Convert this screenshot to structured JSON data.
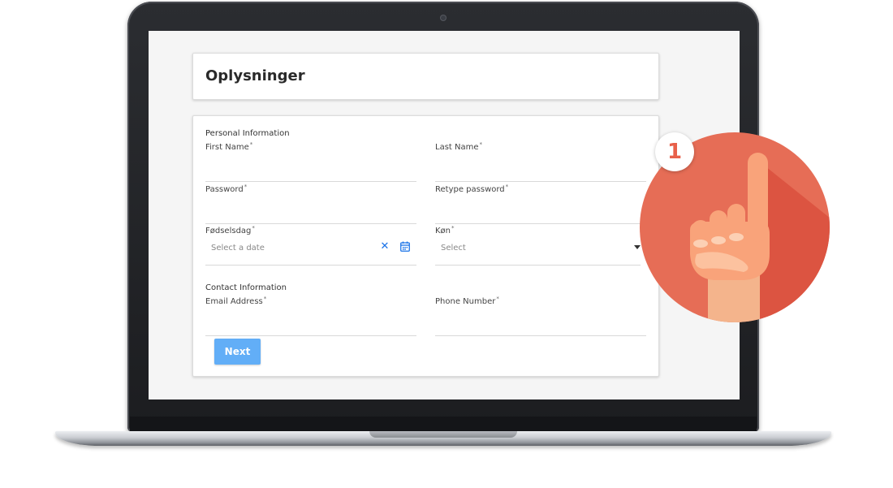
{
  "page": {
    "title": "Oplysninger"
  },
  "form": {
    "personal_section": "Personal Information",
    "first_name_label": "First Name",
    "last_name_label": "Last Name",
    "password_label": "Password",
    "retype_password_label": "Retype password",
    "birthday_label": "Fødselsdag",
    "birthday_placeholder": "Select a date",
    "gender_label": "Køn",
    "gender_selected": "Select",
    "contact_section": "Contact Information",
    "email_label": "Email Address",
    "phone_label": "Phone Number",
    "required_marker": "*",
    "next_label": "Next"
  },
  "badge": {
    "step_number": "1",
    "icon": "pointing-finger-icon"
  },
  "colors": {
    "accent": "#62aef7",
    "icon_blue": "#1a73e8",
    "badge_red": "#e8604a"
  }
}
